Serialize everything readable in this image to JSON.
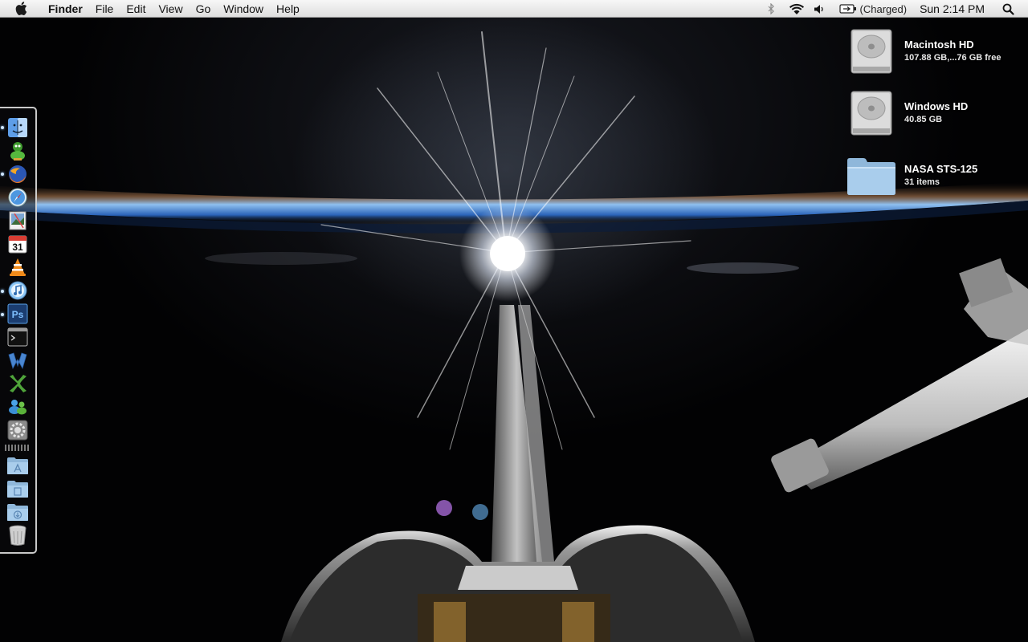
{
  "menubar": {
    "apple_icon": "apple-icon",
    "app_name": "Finder",
    "menus": [
      "File",
      "Edit",
      "View",
      "Go",
      "Window",
      "Help"
    ],
    "battery_status": "(Charged)",
    "clock": "Sun 2:14 PM",
    "status_icons": [
      "bluetooth-icon",
      "wifi-icon",
      "volume-icon",
      "battery-icon",
      "spotlight-icon"
    ]
  },
  "desktop": {
    "icons": [
      {
        "name": "Macintosh HD",
        "info": "107.88 GB,...76 GB free",
        "icon": "hard-drive-icon"
      },
      {
        "name": "Windows HD",
        "info": "40.85 GB",
        "icon": "hard-drive-icon"
      },
      {
        "name": "NASA STS-125",
        "info": "31 items",
        "icon": "folder-icon"
      }
    ]
  },
  "dock": {
    "apps": [
      {
        "icon": "finder-icon",
        "running": true
      },
      {
        "icon": "adium-icon",
        "running": false
      },
      {
        "icon": "firefox-icon",
        "running": true
      },
      {
        "icon": "safari-icon",
        "running": false
      },
      {
        "icon": "preview-icon",
        "running": false
      },
      {
        "icon": "ical-icon",
        "running": false,
        "text": "31"
      },
      {
        "icon": "vlc-icon",
        "running": false
      },
      {
        "icon": "itunes-icon",
        "running": true
      },
      {
        "icon": "photoshop-icon",
        "running": true,
        "text": "Ps"
      },
      {
        "icon": "terminal-icon",
        "running": false
      },
      {
        "icon": "word-icon",
        "running": false
      },
      {
        "icon": "excel-icon",
        "running": false
      },
      {
        "icon": "messenger-icon",
        "running": false
      },
      {
        "icon": "system-preferences-icon",
        "running": false
      }
    ],
    "folders": [
      {
        "icon": "applications-folder-icon"
      },
      {
        "icon": "documents-folder-icon"
      },
      {
        "icon": "downloads-folder-icon"
      },
      {
        "icon": "trash-icon"
      }
    ]
  },
  "colors": {
    "earth_limb": "#6fa8e6",
    "sun_glow": "#ffffff",
    "menubar_top": "#f7f7f7",
    "running_dot": "#cfe6ff"
  }
}
